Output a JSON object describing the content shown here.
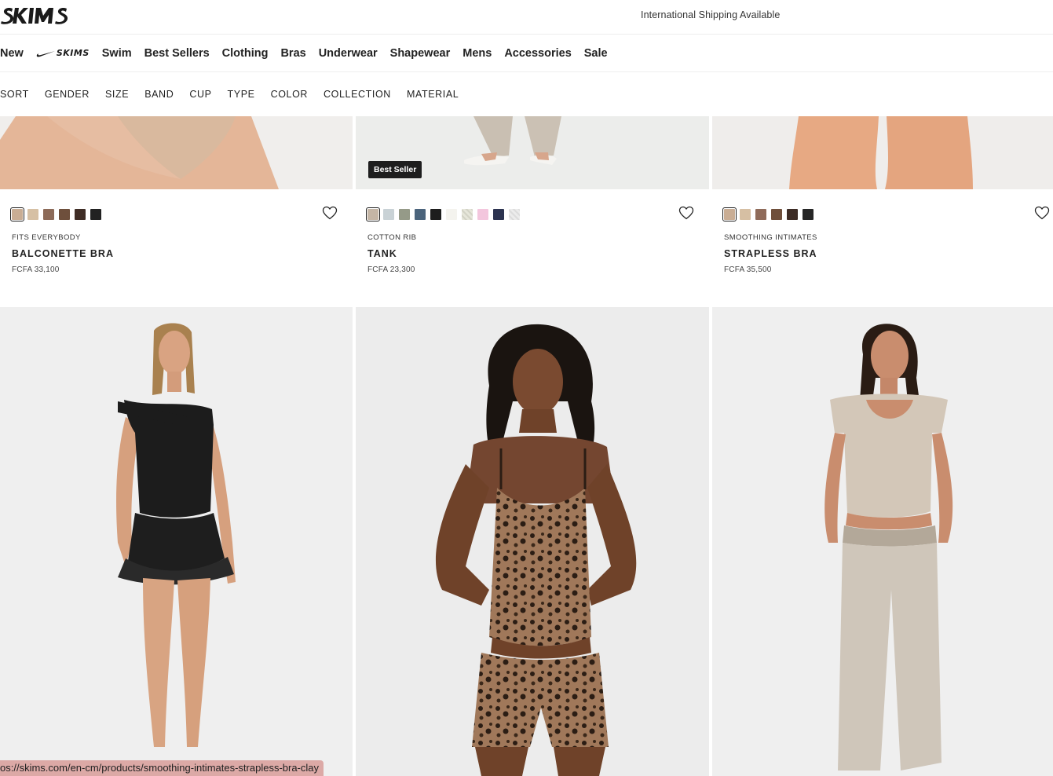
{
  "header": {
    "logo": "SKIMS",
    "shipping": "International Shipping Available"
  },
  "nav": {
    "items": [
      "New",
      "Swim",
      "Best Sellers",
      "Clothing",
      "Bras",
      "Underwear",
      "Shapewear",
      "Mens",
      "Accessories",
      "Sale"
    ],
    "nike_skims_label": "SKIMS"
  },
  "filters": [
    "SORT",
    "GENDER",
    "SIZE",
    "BAND",
    "CUP",
    "TYPE",
    "COLOR",
    "COLLECTION",
    "MATERIAL"
  ],
  "products": [
    {
      "collection": "FITS EVERYBODY",
      "name": "BALCONETTE BRA",
      "price": "FCFA 33,100",
      "badge": "",
      "swatches": [
        "#c9ad94",
        "#d6c0a4",
        "#8c6a58",
        "#6e4f3c",
        "#3f2d26",
        "#222222"
      ]
    },
    {
      "collection": "COTTON RIB",
      "name": "TANK",
      "price": "FCFA 23,300",
      "badge": "Best Seller",
      "swatches": [
        "#c4b5a5",
        "#c9d2d6",
        "#959a88",
        "#4b647c",
        "#1d1d1d",
        "#f4f3ee",
        "#e6e6da",
        "#f3c6dd",
        "#2c3350",
        "#ececec"
      ]
    },
    {
      "collection": "SMOOTHING INTIMATES",
      "name": "STRAPLESS BRA",
      "price": "FCFA 35,500",
      "badge": "",
      "swatches": [
        "#c9ad94",
        "#d6bfa3",
        "#8f6b5a",
        "#6f4f3b",
        "#3d2c25",
        "#262626"
      ]
    }
  ],
  "status_url": "os://skims.com/en-cm/products/smoothing-intimates-strapless-bra-clay"
}
